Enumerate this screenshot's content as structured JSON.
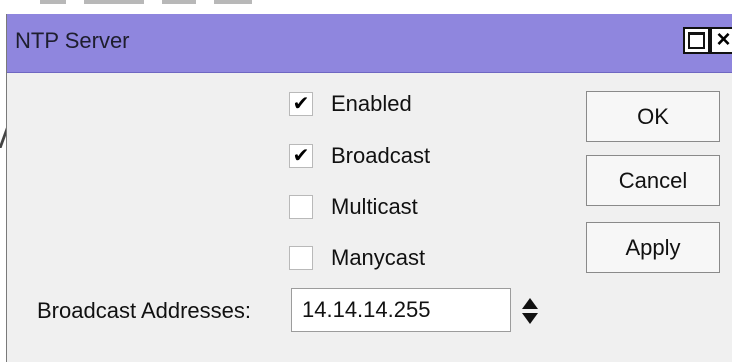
{
  "window": {
    "title": "NTP Server"
  },
  "options": [
    {
      "label": "Enabled",
      "checked": true
    },
    {
      "label": "Broadcast",
      "checked": true
    },
    {
      "label": "Multicast",
      "checked": false
    },
    {
      "label": "Manycast",
      "checked": false
    }
  ],
  "buttons": {
    "ok": "OK",
    "cancel": "Cancel",
    "apply": "Apply"
  },
  "broadcast_addresses": {
    "label": "Broadcast Addresses:",
    "value": "14.14.14.255"
  },
  "icons": {
    "maximize": "maximize-icon",
    "close": "close-icon",
    "checkmark": "check-icon",
    "spinner": "updown-spinner-icon"
  },
  "colors": {
    "titlebar": "#8f86de",
    "window_bg": "#f0f0f0"
  }
}
